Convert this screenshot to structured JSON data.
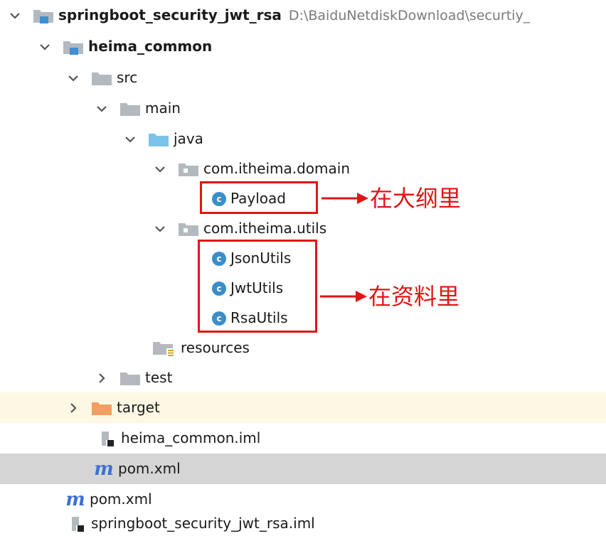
{
  "tree": {
    "root": {
      "label": "springboot_security_jwt_rsa",
      "path": "D:\\BaiduNetdiskDownload\\securtiy_"
    },
    "module": {
      "label": "heima_common"
    },
    "src": {
      "label": "src"
    },
    "main": {
      "label": "main"
    },
    "java": {
      "label": "java"
    },
    "pkg_domain": {
      "label": "com.itheima.domain"
    },
    "payload": {
      "label": "Payload",
      "icon_letter": "c"
    },
    "pkg_utils": {
      "label": "com.itheima.utils"
    },
    "json_utils": {
      "label": "JsonUtils",
      "icon_letter": "c"
    },
    "jwt_utils": {
      "label": "JwtUtils",
      "icon_letter": "c"
    },
    "rsa_utils": {
      "label": "RsaUtils",
      "icon_letter": "c"
    },
    "resources": {
      "label": "resources"
    },
    "test": {
      "label": "test"
    },
    "target": {
      "label": "target"
    },
    "module_iml": {
      "label": "heima_common.iml"
    },
    "module_pom": {
      "label": "pom.xml",
      "icon_letter": "m"
    },
    "root_pom": {
      "label": "pom.xml",
      "icon_letter": "m"
    },
    "root_iml": {
      "label": "springboot_security_jwt_rsa.iml"
    }
  },
  "annotations": {
    "outline": "在大纲里",
    "materials": "在资料里"
  },
  "colors": {
    "annotation_red": "#e01616",
    "folder_gray": "#b4b9c0",
    "folder_blue": "#7cc3ea",
    "folder_orange": "#f0a060",
    "module_blue": "#3f8fd2",
    "class_icon_blue": "#3b8ec7",
    "maven_blue": "#3a6fd6",
    "selected_row": "#d5d5d5",
    "excluded_row": "#fcf8e3"
  },
  "icons": {
    "expanded": "chevron-down-icon",
    "collapsed": "chevron-right-icon",
    "folder": "folder-icon",
    "module": "module-folder-icon",
    "package": "package-icon",
    "class": "java-class-icon",
    "maven": "maven-pom-icon",
    "iml": "iml-file-icon",
    "resources": "resources-folder-icon"
  }
}
